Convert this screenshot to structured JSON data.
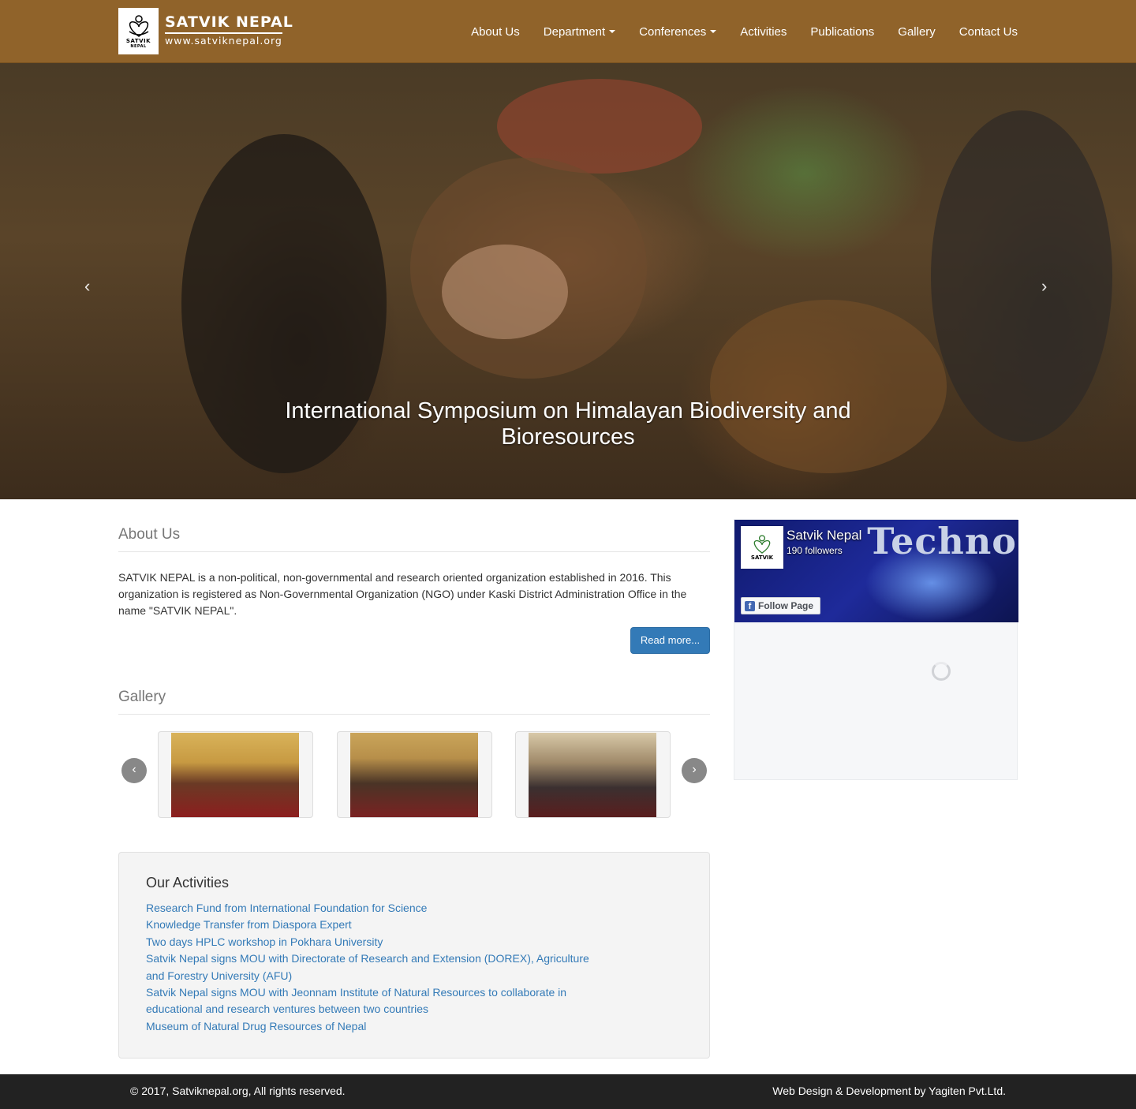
{
  "brand": {
    "title": "SATVIK NEPAL",
    "url": "www.satviknepal.org",
    "logo_text": "SATVIK",
    "logo_sub": "NEPAL"
  },
  "nav": [
    {
      "label": "About Us",
      "dropdown": false
    },
    {
      "label": "Department",
      "dropdown": true
    },
    {
      "label": "Conferences",
      "dropdown": true
    },
    {
      "label": "Activities",
      "dropdown": false
    },
    {
      "label": "Publications",
      "dropdown": false
    },
    {
      "label": "Gallery",
      "dropdown": false
    },
    {
      "label": "Contact Us",
      "dropdown": false
    }
  ],
  "hero": {
    "caption": "International Symposium on Himalayan Biodiversity and Bioresources",
    "prev": "‹",
    "next": "›"
  },
  "about": {
    "heading": "About Us",
    "text": "SATVIK NEPAL is a non-political, non-governmental and research oriented organization established in 2016. This organization is registered as Non-Governmental Organization (NGO) under Kaski District Administration Office in the name \"SATVIK NEPAL\".",
    "read_more": "Read more..."
  },
  "gallery": {
    "heading": "Gallery",
    "prev": "‹",
    "next": "›"
  },
  "activities": {
    "heading": "Our Activities",
    "items": [
      "Research Fund from International Foundation for Science",
      "Knowledge Transfer from Diaspora Expert",
      "Two days HPLC workshop in Pokhara University",
      "Satvik Nepal signs MOU with Directorate of Research and Extension (DOREX), Agriculture and Forestry University (AFU)",
      "Satvik Nepal signs MOU with Jeonnam Institute of Natural Resources to collaborate in educational and research ventures between two countries",
      "Museum of Natural Drug Resources of Nepal"
    ]
  },
  "facebook": {
    "page_name": "Satvik Nepal",
    "followers": "190 followers",
    "follow_label": "Follow Page",
    "cover_text": "Techno",
    "icon": "f"
  },
  "footer": {
    "copyright": "© 2017, Satviknepal.org, All rights reserved.",
    "credit": "Web Design & Development by Yagiten Pvt.Ltd."
  },
  "colors": {
    "navbar": "#90632a",
    "link": "#337ab7",
    "button": "#337ab7",
    "footer": "#222222"
  }
}
